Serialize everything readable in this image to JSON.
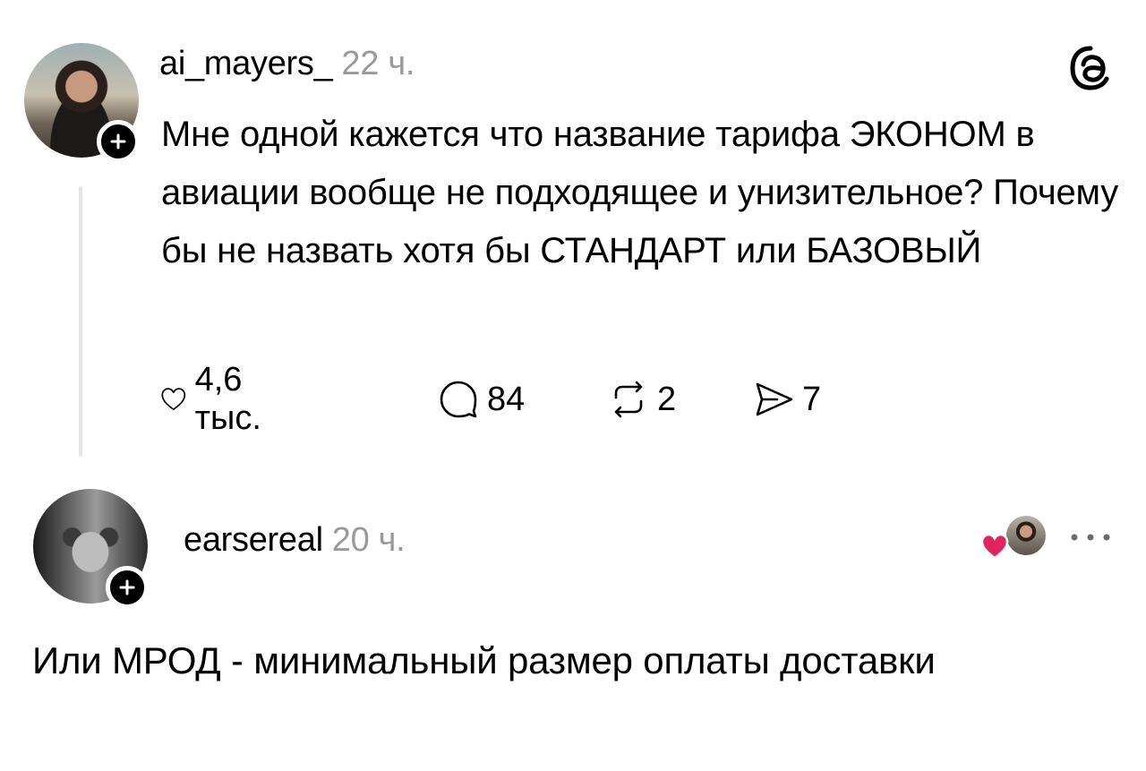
{
  "post": {
    "username": "ai_mayers_",
    "time": "22 ч.",
    "text": "Мне одной кажется что название тарифа ЭКОНОМ в авиации вообще не подходящее и унизительное? Почему бы не назвать хотя бы СТАНДАРТ или БАЗОВЫЙ",
    "actions": {
      "likes": "4,6 тыс.",
      "replies": "84",
      "reposts": "2",
      "shares": "7"
    }
  },
  "reply": {
    "username": "earsereal",
    "time": "20 ч.",
    "text": "Или МРОД - минимальный размер оплаты доставки"
  },
  "icons": {
    "logo": "threads-logo-icon",
    "like": "heart-icon",
    "reply": "comment-icon",
    "repost": "repost-icon",
    "share": "share-icon",
    "follow": "plus-icon",
    "more": "more-dots-icon"
  },
  "colors": {
    "text": "#000000",
    "muted": "#9a9a9a",
    "heart_red": "#e0245e",
    "thread_line": "#e5e5e5"
  }
}
